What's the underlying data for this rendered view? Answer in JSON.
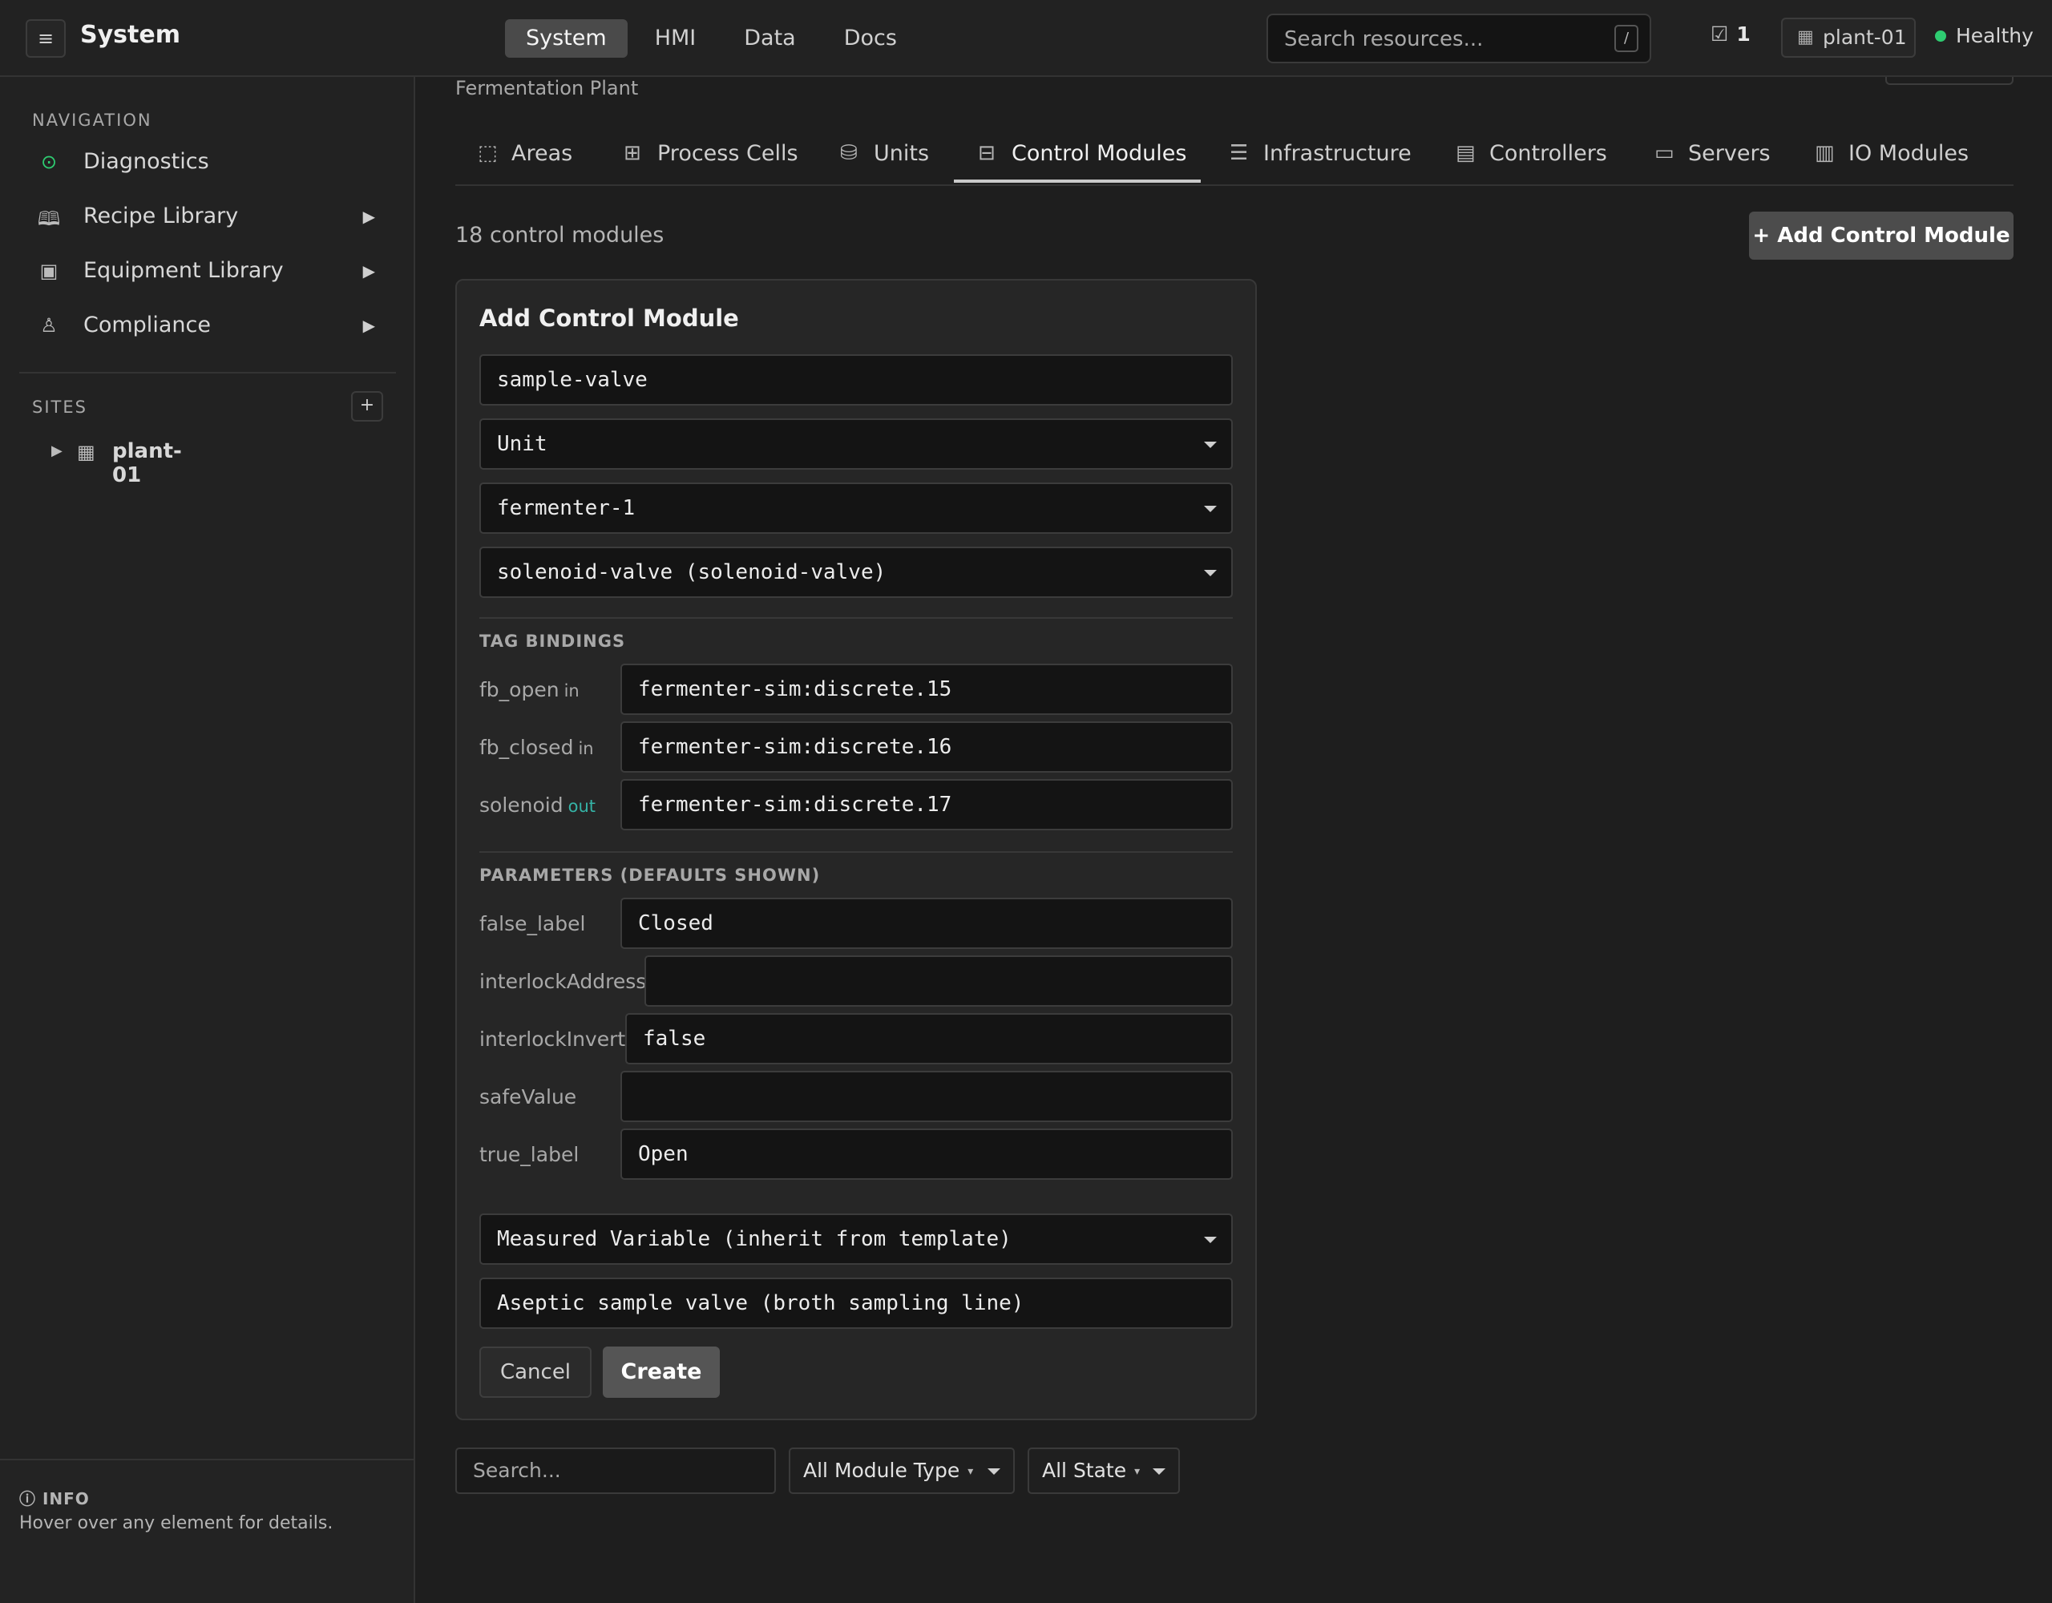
{
  "app": {
    "menu_icon": "≡",
    "title": "System"
  },
  "top_nav": {
    "tabs": [
      {
        "label": "System",
        "active": true
      },
      {
        "label": "HMI",
        "active": false
      },
      {
        "label": "Data",
        "active": false
      },
      {
        "label": "Docs",
        "active": false
      }
    ],
    "search_placeholder": "Search resources...",
    "search_shortcut": "/",
    "task_count": "1",
    "site_label": "plant-01",
    "health_label": "Healthy",
    "health_color": "#2ecc71"
  },
  "sidebar": {
    "navigation_label": "NAVIGATION",
    "items": [
      {
        "label": "Diagnostics",
        "icon": "target-icon",
        "has_children": false
      },
      {
        "label": "Recipe Library",
        "icon": "book-icon",
        "has_children": true
      },
      {
        "label": "Equipment Library",
        "icon": "equipment-icon",
        "has_children": true
      },
      {
        "label": "Compliance",
        "icon": "award-icon",
        "has_children": true
      }
    ],
    "sites_label": "SITES",
    "add_site_label": "+",
    "sites": [
      {
        "label": "plant-01"
      }
    ],
    "info_title": "INFO",
    "info_text": "Hover over any element for details."
  },
  "main": {
    "plant_name": "Fermentation Plant",
    "tabs": [
      {
        "label": "Areas",
        "icon": "areas-icon",
        "active": false
      },
      {
        "label": "Process Cells",
        "icon": "process-cells-icon",
        "active": false
      },
      {
        "label": "Units",
        "icon": "database-icon",
        "active": false
      },
      {
        "label": "Control Modules",
        "icon": "control-module-icon",
        "active": true
      },
      {
        "label": "Infrastructure",
        "icon": "server-stack-icon",
        "active": false
      },
      {
        "label": "Controllers",
        "icon": "controller-icon",
        "active": false
      },
      {
        "label": "Servers",
        "icon": "server-icon",
        "active": false
      },
      {
        "label": "IO Modules",
        "icon": "io-module-icon",
        "active": false
      }
    ],
    "count_text": "18 control modules",
    "add_button_label": "+ Add Control Module"
  },
  "form": {
    "title": "Add Control Module",
    "name_value": "sample-valve",
    "parent_type": "Unit",
    "parent": "fermenter-1",
    "template": "solenoid-valve (solenoid-valve)",
    "tag_bindings_label": "TAG BINDINGS",
    "tag_bindings": [
      {
        "name": "fb_open",
        "direction": "in",
        "value": "fermenter-sim:discrete.15"
      },
      {
        "name": "fb_closed",
        "direction": "in",
        "value": "fermenter-sim:discrete.16"
      },
      {
        "name": "solenoid",
        "direction": "out",
        "value": "fermenter-sim:discrete.17"
      }
    ],
    "parameters_label": "PARAMETERS (DEFAULTS SHOWN)",
    "parameters": [
      {
        "name": "false_label",
        "value": "Closed"
      },
      {
        "name": "interlockAddress",
        "value": ""
      },
      {
        "name": "interlockInvert",
        "value": "false"
      },
      {
        "name": "safeValue",
        "value": ""
      },
      {
        "name": "true_label",
        "value": "Open"
      }
    ],
    "measured_variable": "Measured Variable (inherit from template)",
    "description": "Aseptic sample valve (broth sampling line)",
    "cancel_label": "Cancel",
    "create_label": "Create"
  },
  "filters": {
    "search_placeholder": "Search...",
    "module_type": "All Module Type",
    "state": "All State"
  }
}
